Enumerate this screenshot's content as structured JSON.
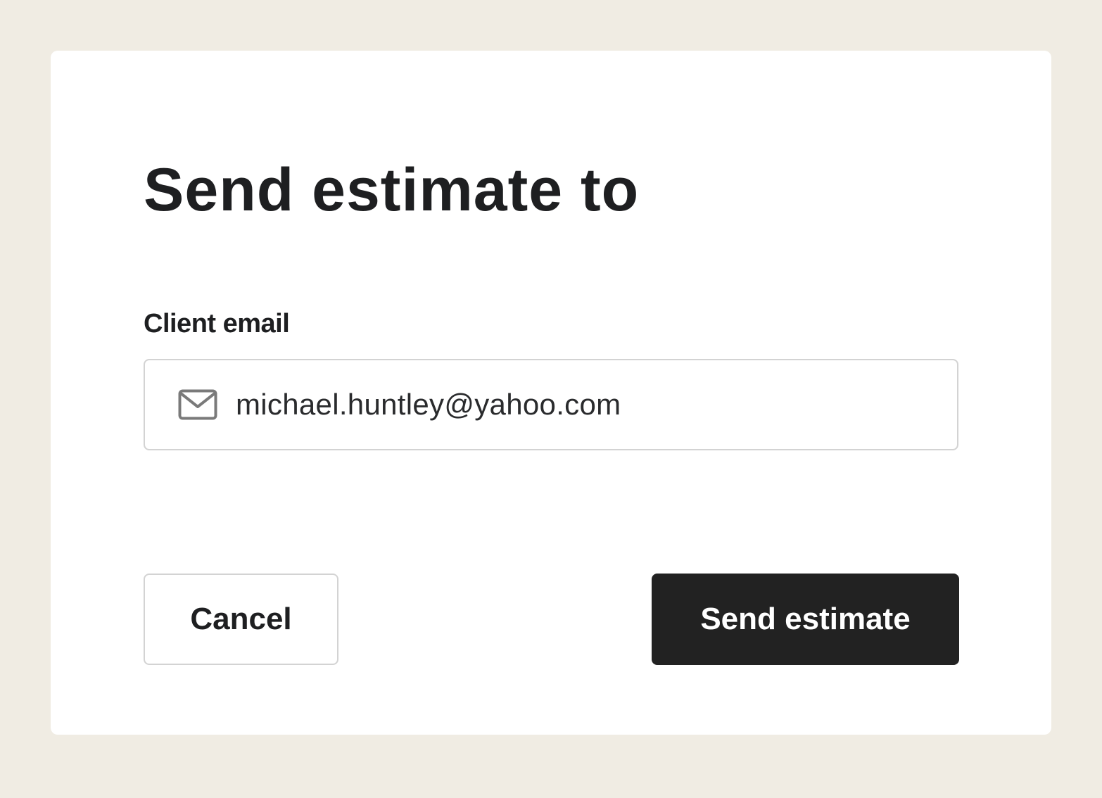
{
  "dialog": {
    "title": "Send estimate to",
    "field_label": "Client email",
    "email": {
      "value": "michael.huntley@yahoo.com",
      "icon": "mail-icon"
    },
    "cancel_label": "Cancel",
    "send_label": "Send estimate"
  },
  "colors": {
    "page_background": "#f0ece3",
    "dialog_background": "#ffffff",
    "text": "#1e1f21",
    "primary_button": "#222222",
    "border": "#d3d3d3"
  }
}
